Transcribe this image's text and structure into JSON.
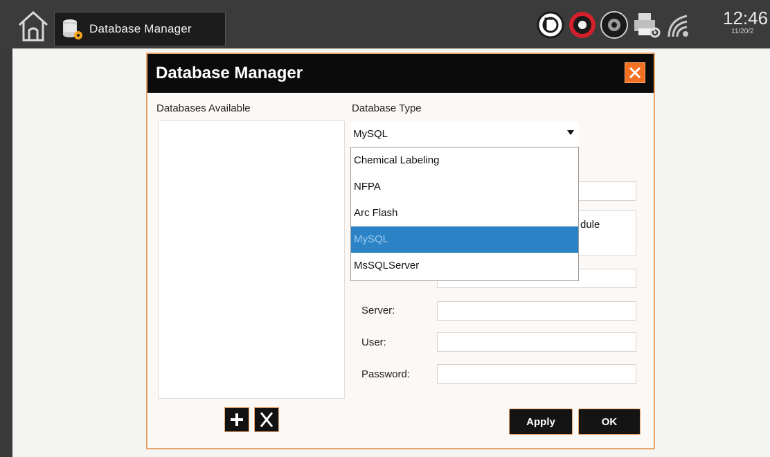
{
  "taskbar": {
    "app_tab_label": "Database Manager",
    "clock_time": "12:46",
    "clock_date": "11/20/2"
  },
  "dialog": {
    "title": "Database Manager",
    "databases_label": "Databases Available",
    "database_type_label": "Database Type",
    "selected_type": "MySQL",
    "type_options": [
      "Chemical Labeling",
      "NFPA",
      "Arc Flash",
      "MySQL",
      "MsSQLServer"
    ],
    "selected_option_index": 3,
    "partial_text": "dule",
    "fields": {
      "server_label": "Server:",
      "user_label": "User:",
      "password_label": "Password:"
    },
    "buttons": {
      "add": "+",
      "delete": "X",
      "apply": "Apply",
      "ok": "OK"
    }
  },
  "colors": {
    "accent": "#f36f21",
    "border": "#e9a46a",
    "selection": "#2b83c6",
    "header": "#0b0b0b"
  }
}
